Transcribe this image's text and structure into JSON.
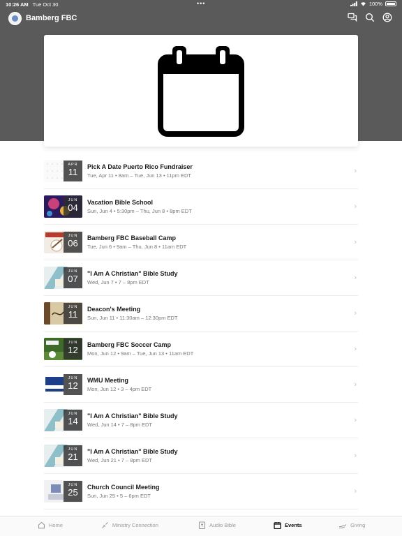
{
  "status": {
    "time": "10:26 AM",
    "date": "Tue Oct 30",
    "dots": "•••",
    "battery": "100%"
  },
  "app": {
    "title": "Bamberg FBC"
  },
  "icons": {
    "chat": "chat-icon",
    "search": "search-icon",
    "profile": "profile-icon",
    "hero": "calendar-icon"
  },
  "events": [
    {
      "title": "Pick A Date Puerto Rico Fundraiser",
      "time": "Tue, Apr 11 • 8am – Tue, Jun 13 • 11pm EDT",
      "month": "APR",
      "day": "11"
    },
    {
      "title": "Vacation Bible School",
      "time": "Sun, Jun 4 • 5:30pm – Thu, Jun 8 • 8pm EDT",
      "month": "JUN",
      "day": "04"
    },
    {
      "title": "Bamberg FBC Baseball Camp",
      "time": "Tue, Jun 6 • 9am – Thu, Jun 8 • 11am EDT",
      "month": "JUN",
      "day": "06"
    },
    {
      "title": "\"I Am A Christian\" Bible Study",
      "time": "Wed, Jun 7 • 7 – 8pm EDT",
      "month": "JUN",
      "day": "07"
    },
    {
      "title": "Deacon's Meeting",
      "time": "Sun, Jun 11 • 11:30am – 12:30pm EDT",
      "month": "JUN",
      "day": "11"
    },
    {
      "title": "Bamberg FBC Soccer Camp",
      "time": "Mon, Jun 12 • 9am – Tue, Jun 13 • 11am EDT",
      "month": "JUN",
      "day": "12"
    },
    {
      "title": "WMU Meeting",
      "time": "Mon, Jun 12 • 3 – 4pm EDT",
      "month": "JUN",
      "day": "12"
    },
    {
      "title": "\"I Am A Christian\" Bible Study",
      "time": "Wed, Jun 14 • 7 – 8pm EDT",
      "month": "JUN",
      "day": "14"
    },
    {
      "title": "\"I Am A Christian\" Bible Study",
      "time": "Wed, Jun 21 • 7 – 8pm EDT",
      "month": "JUN",
      "day": "21"
    },
    {
      "title": "Church Council Meeting",
      "time": "Sun, Jun 25 • 5 – 6pm EDT",
      "month": "JUN",
      "day": "25"
    }
  ],
  "tabs": [
    {
      "label": "Home",
      "icon": "home-icon",
      "active": false
    },
    {
      "label": "Ministry Connection",
      "icon": "connection-icon",
      "active": false
    },
    {
      "label": "Audio Bible",
      "icon": "bible-icon",
      "active": false
    },
    {
      "label": "Events",
      "icon": "calendar-icon",
      "active": true
    },
    {
      "label": "Giving",
      "icon": "giving-icon",
      "active": false
    }
  ],
  "colors": {
    "header": "#5a5a5a",
    "badge": "#2d2d2d",
    "active_tab": "#111111",
    "inactive_tab": "#9a9a9a"
  }
}
